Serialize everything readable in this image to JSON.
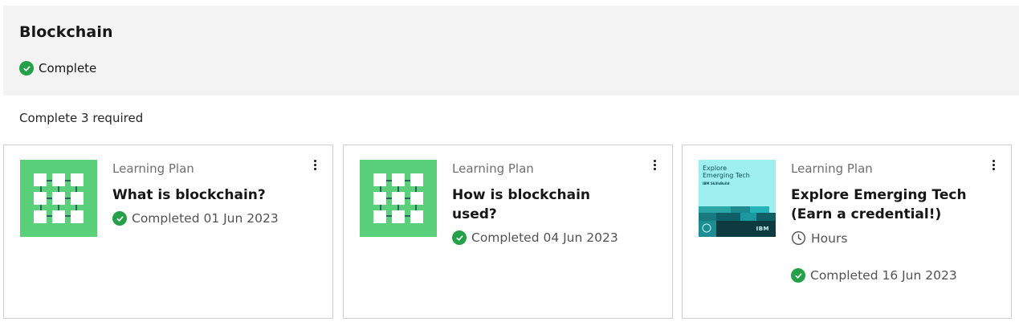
{
  "header": {
    "title": "Blockchain",
    "status": "Complete"
  },
  "requirement": "Complete 3 required",
  "cards": [
    {
      "type": "Learning Plan",
      "title": "What is blockchain?",
      "completed": "Completed 01 Jun 2023",
      "thumbnail_icon": "blockchain-grid-icon"
    },
    {
      "type": "Learning Plan",
      "title": "How is blockchain used?",
      "completed": "Completed 04 Jun 2023",
      "thumbnail_icon": "blockchain-grid-icon"
    },
    {
      "type": "Learning Plan",
      "title": "Explore Emerging Tech (Earn a credential!)",
      "duration": "Hours",
      "completed": "Completed 16 Jun 2023",
      "thumbnail": {
        "line1": "Explore",
        "line2": "Emerging Tech",
        "tag": "IBM SkillsBuild",
        "brand": "IBM"
      }
    }
  ],
  "colors": {
    "success": "#24a148",
    "thumb_green": "#5ad07a",
    "thumb_cyan": "#9ef0f0",
    "header_bg": "#f3f3f3"
  }
}
